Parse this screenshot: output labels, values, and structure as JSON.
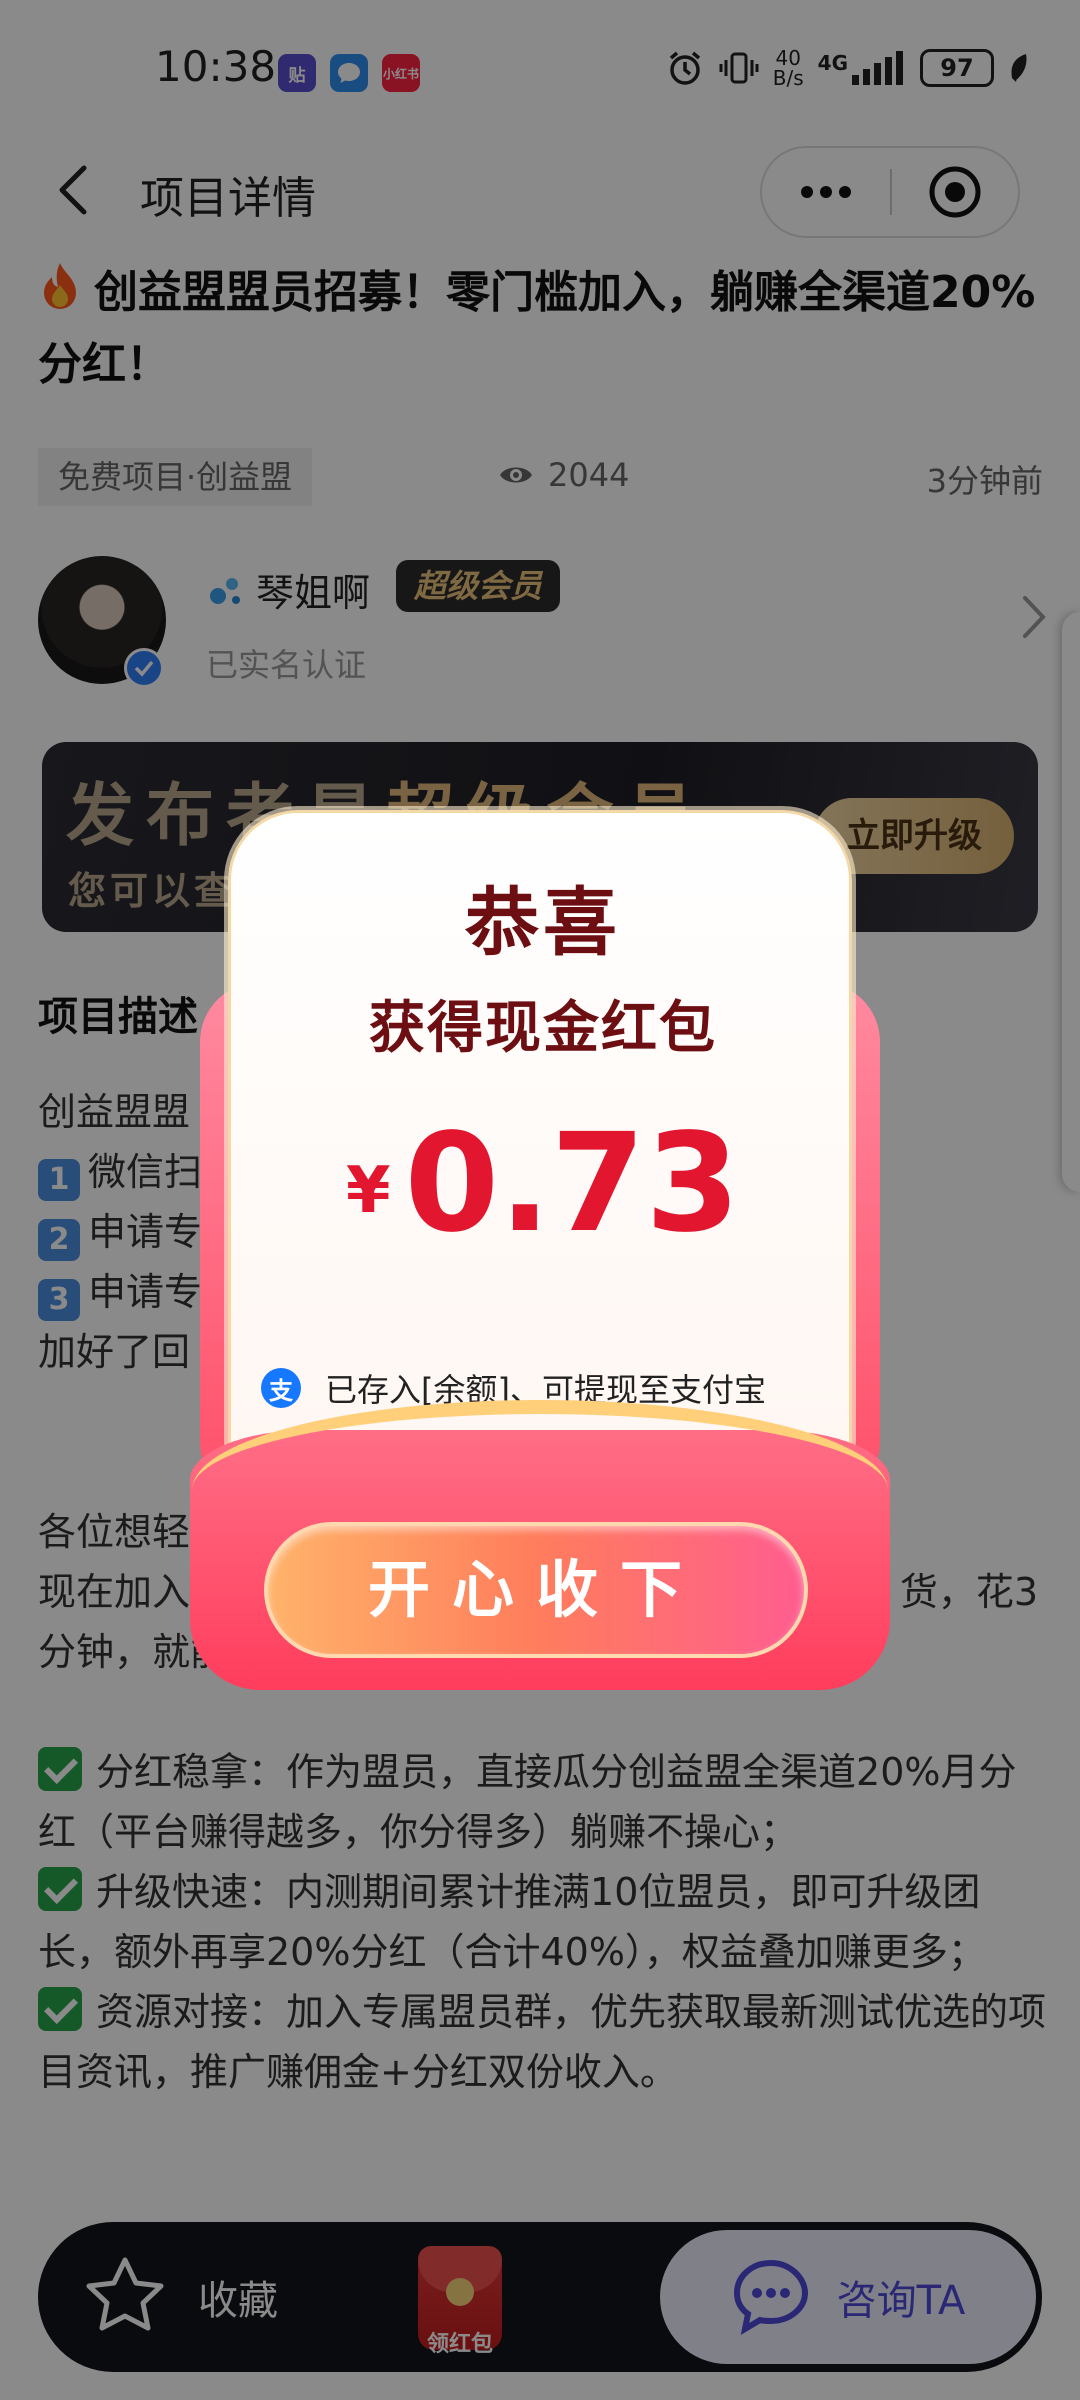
{
  "status_bar": {
    "time": "10:38",
    "apps": [
      {
        "name": "贴",
        "color": "#5a4fcf"
      },
      {
        "name": "💬",
        "color": "#2f8ff0"
      },
      {
        "name": "小红书",
        "color": "#ff2442"
      }
    ],
    "net_speed_value": "40",
    "net_speed_unit": "B/s",
    "signal": "4G",
    "battery": "97"
  },
  "header": {
    "title": "项目详情"
  },
  "article": {
    "title": "创益盟盟员招募！零门槛加入，躺赚全渠道20%分红！",
    "tag": "免费项目·创益盟",
    "views": "2044",
    "time_ago": "3分钟前"
  },
  "author": {
    "name": "琴姐啊",
    "badge": "超级会员",
    "verified_text": "已实名认证"
  },
  "banner": {
    "title_prefix": "发布者是",
    "title_highlight": "超级会员",
    "subtitle": "您可以查",
    "button": "立即升级"
  },
  "description": {
    "heading": "项目描述",
    "intro_lines": [
      "创益盟盟",
      "微信扫",
      "申请专",
      "申请专",
      "加好了回"
    ],
    "para2_lines": [
      "各位想轻",
      "现在加入",
      "分钟，就能"
    ],
    "para2_tail": "货，花3",
    "bullets": [
      {
        "label": "分红稳拿",
        "text": "作为盟员，直接瓜分创益盟全渠道20%月分红（平台赚得越多，你分得多）躺赚不操心；"
      },
      {
        "label": "升级快速",
        "text": "内测期间累计推满10位盟员，即可升级团长，额外再享20%分红（合计40%），权益叠加赚更多；"
      },
      {
        "label": "资源对接",
        "text": "加入专属盟员群，优先获取最新测试优选的项目资讯，推广赚佣金+分红双份收入。"
      }
    ]
  },
  "bottom_bar": {
    "favorite": "收藏",
    "red_packet": "领红包",
    "consult": "咨询TA"
  },
  "modal": {
    "congrats": "恭喜",
    "subtitle": "获得现金红包",
    "currency": "¥",
    "amount": "0.73",
    "deposit_note": "已存入[余额]、可提现至支付宝",
    "accept_button": "开心收下"
  },
  "colors": {
    "amount": "#e2162f",
    "modal_text": "#6d0f12",
    "accept_gradient_start": "#ffb36a",
    "accept_gradient_end": "#ff5d8f",
    "consult_text": "#4e4ad8"
  }
}
